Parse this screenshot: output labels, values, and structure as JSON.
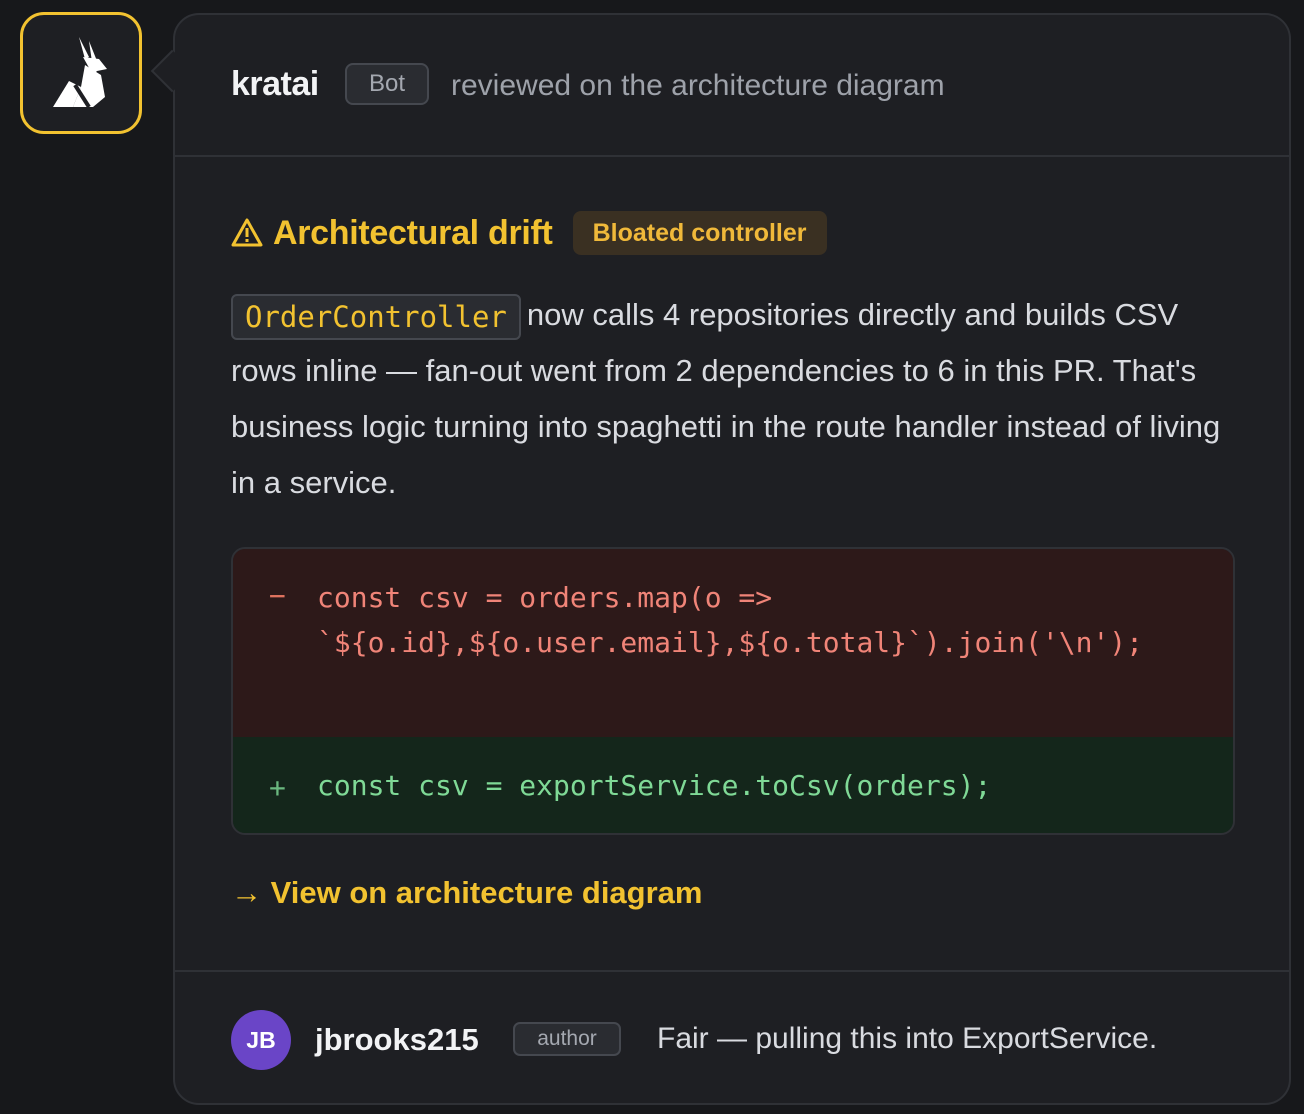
{
  "review": {
    "reviewer": {
      "username": "kratai",
      "badge": "Bot",
      "action": "reviewed on the architecture diagram",
      "avatar_icon": "rabbit-logo-icon"
    },
    "finding": {
      "icon": "warning-icon",
      "title": "Architectural drift",
      "tag": "Bloated controller",
      "inline_code": "OrderController",
      "description": "now calls 4 repositories directly and builds CSV rows inline — fan-out went from 2 dependencies to 6 in this PR. That's business logic turning into spaghetti in the route handler instead of living in a service."
    },
    "diff": {
      "removed_sign": "−",
      "removed_code": "const csv = orders.map(o =>\n`${o.id},${o.user.email},${o.total}`).join('\\n');",
      "added_sign": "+",
      "added_code": "const csv = exportService.toCsv(orders);"
    },
    "link": {
      "arrow": "→",
      "label": "View on architecture diagram"
    }
  },
  "reply": {
    "avatar_initials": "JB",
    "username": "jbrooks215",
    "badge": "author",
    "text": "Fair — pulling this into ExportService."
  },
  "colors": {
    "accent": "#f2c230",
    "background": "#17181b",
    "card": "#1e1f23",
    "diff_removed_bg": "#2d1919",
    "diff_added_bg": "#14261b",
    "reply_avatar": "#6a45c7"
  }
}
